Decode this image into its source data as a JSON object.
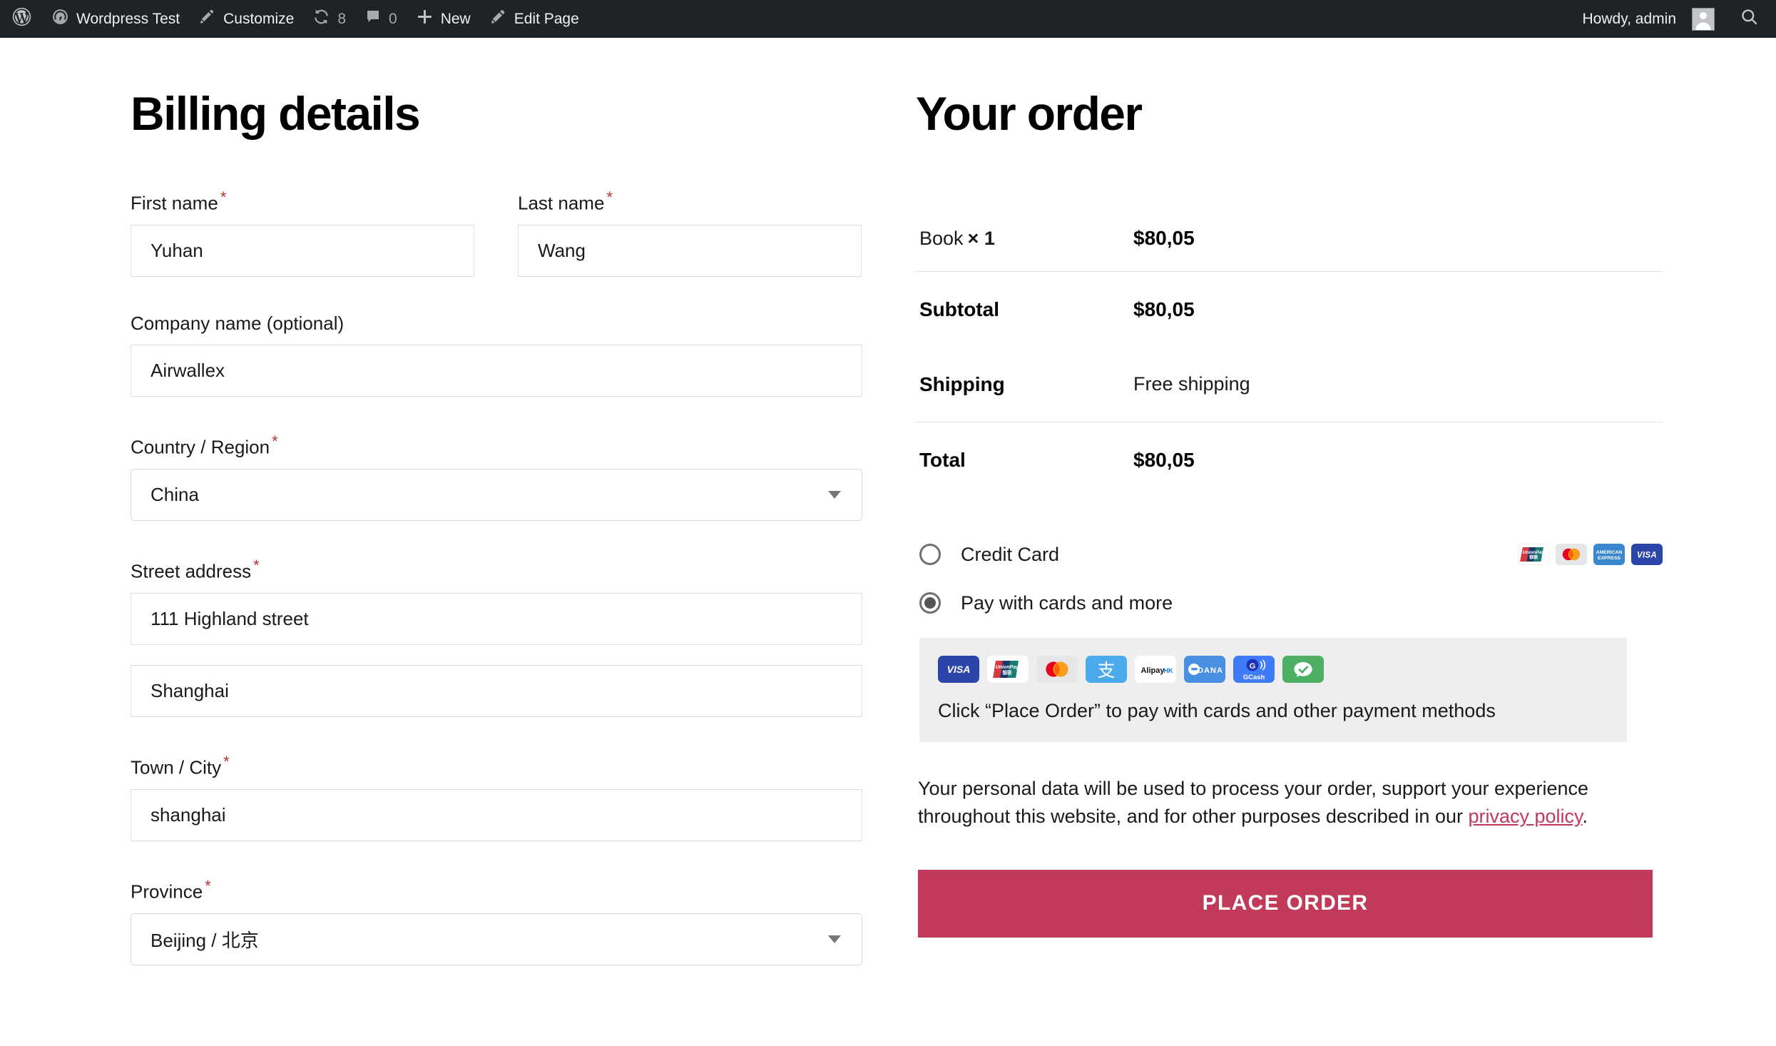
{
  "adminbar": {
    "wp_logo_icon": "wordpress-logo-icon",
    "site_icon": "dashboard-site-icon",
    "site_name": "Wordpress Test",
    "customize_icon": "paintbrush-icon",
    "customize_label": "Customize",
    "updates_icon": "update-refresh-icon",
    "updates_count": "8",
    "comments_icon": "comment-bubble-icon",
    "comments_count": "0",
    "new_icon": "plus-icon",
    "new_label": "New",
    "edit_icon": "pencil-edit-icon",
    "edit_label": "Edit Page",
    "howdy": "Howdy, admin",
    "avatar_icon": "user-avatar-icon",
    "search_icon": "search-icon"
  },
  "billing": {
    "title": "Billing details",
    "required_mark": "*",
    "fields": {
      "first_name": {
        "label": "First name",
        "value": "Yuhan",
        "required": true
      },
      "last_name": {
        "label": "Last name",
        "value": "Wang",
        "required": true
      },
      "company": {
        "label": "Company name (optional)",
        "value": "Airwallex",
        "required": false
      },
      "country": {
        "label": "Country / Region",
        "value": "China",
        "required": true
      },
      "street": {
        "label": "Street address",
        "value": "111 Highland street",
        "required": true
      },
      "street2": {
        "label": "",
        "value": "Shanghai",
        "required": false
      },
      "city": {
        "label": "Town / City",
        "value": "shanghai",
        "required": true
      },
      "province": {
        "label": "Province",
        "value": "Beijing / 北京",
        "required": true
      }
    }
  },
  "order": {
    "title": "Your order",
    "product": {
      "name": "Book",
      "qty": "× 1",
      "price": "$80,05"
    },
    "subtotal": {
      "label": "Subtotal",
      "value": "$80,05"
    },
    "shipping": {
      "label": "Shipping",
      "value": "Free shipping"
    },
    "total": {
      "label": "Total",
      "value": "$80,05"
    }
  },
  "payment": {
    "methods": [
      {
        "label": "Credit Card",
        "selected": false
      },
      {
        "label": "Pay with cards and more",
        "selected": true
      }
    ],
    "credit_card_icons": [
      "unionpay-icon",
      "mastercard-icon",
      "amex-icon",
      "visa-icon"
    ],
    "wallet_icons": [
      "visa-icon",
      "unionpay-icon",
      "mastercard-icon",
      "alipay-icon",
      "alipayhk-icon",
      "dana-icon",
      "gcash-icon",
      "wechatpay-icon"
    ],
    "note": "Click “Place Order” to pay with cards and other payment methods"
  },
  "privacy": {
    "text_before": "Your personal data will be used to process your order, support your experience throughout this website, and for other purposes described in our ",
    "link": "privacy policy",
    "text_after": "."
  },
  "place_order": {
    "label": "PLACE ORDER"
  },
  "colors": {
    "adminbar_bg": "#1d2327",
    "button": "#c23a5a",
    "link": "#c2395b",
    "required": "#b23535",
    "payment_box_bg": "#eeeeee"
  }
}
